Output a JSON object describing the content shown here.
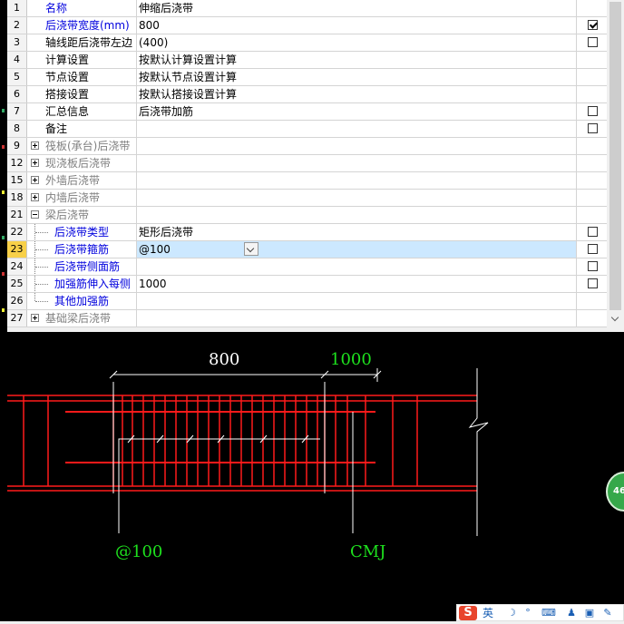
{
  "rows": [
    {
      "num": "1",
      "name": "名称",
      "value": "伸缩后浇带",
      "color": "blue",
      "checkbox": null,
      "expand": null,
      "indent": 0
    },
    {
      "num": "2",
      "name": "后浇带宽度(mm)",
      "value": "800",
      "color": "blue",
      "checkbox": true,
      "expand": null,
      "indent": 0
    },
    {
      "num": "3",
      "name": "轴线距后浇带左边",
      "value": "(400)",
      "color": "black",
      "checkbox": false,
      "expand": null,
      "indent": 0
    },
    {
      "num": "4",
      "name": "计算设置",
      "value": "按默认计算设置计算",
      "color": "black",
      "checkbox": null,
      "expand": null,
      "indent": 0
    },
    {
      "num": "5",
      "name": "节点设置",
      "value": "按默认节点设置计算",
      "color": "black",
      "checkbox": null,
      "expand": null,
      "indent": 0
    },
    {
      "num": "6",
      "name": "搭接设置",
      "value": "按默认搭接设置计算",
      "color": "black",
      "checkbox": null,
      "expand": null,
      "indent": 0
    },
    {
      "num": "7",
      "name": "汇总信息",
      "value": "后浇带加筋",
      "color": "black",
      "checkbox": false,
      "expand": null,
      "indent": 0
    },
    {
      "num": "8",
      "name": "备注",
      "value": "",
      "color": "black",
      "checkbox": false,
      "expand": null,
      "indent": 0
    },
    {
      "num": "9",
      "name": "筏板(承台)后浇带",
      "value": "",
      "color": "gray",
      "checkbox": null,
      "expand": "plus",
      "indent": 0
    },
    {
      "num": "12",
      "name": "现浇板后浇带",
      "value": "",
      "color": "gray",
      "checkbox": null,
      "expand": "plus",
      "indent": 0
    },
    {
      "num": "15",
      "name": "外墙后浇带",
      "value": "",
      "color": "gray",
      "checkbox": null,
      "expand": "plus",
      "indent": 0
    },
    {
      "num": "18",
      "name": "内墙后浇带",
      "value": "",
      "color": "gray",
      "checkbox": null,
      "expand": "plus",
      "indent": 0
    },
    {
      "num": "21",
      "name": "梁后浇带",
      "value": "",
      "color": "gray",
      "checkbox": null,
      "expand": "minus",
      "indent": 0
    },
    {
      "num": "22",
      "name": "后浇带类型",
      "value": "矩形后浇带",
      "color": "blue",
      "checkbox": false,
      "expand": null,
      "indent": 1
    },
    {
      "num": "23",
      "name": "后浇带箍筋",
      "value": "@100",
      "color": "blue",
      "checkbox": false,
      "expand": null,
      "indent": 1,
      "selected": true,
      "dropdown": true
    },
    {
      "num": "24",
      "name": "后浇带侧面筋",
      "value": "",
      "color": "blue",
      "checkbox": false,
      "expand": null,
      "indent": 1
    },
    {
      "num": "25",
      "name": "加强筋伸入每侧",
      "value": "1000",
      "color": "blue",
      "checkbox": false,
      "expand": null,
      "indent": 1
    },
    {
      "num": "26",
      "name": "其他加强筋",
      "value": "",
      "color": "blue",
      "checkbox": null,
      "expand": null,
      "indent": 1,
      "last": true
    },
    {
      "num": "27",
      "name": "基础梁后浇带",
      "value": "",
      "color": "gray",
      "checkbox": null,
      "expand": "plus",
      "indent": 0
    }
  ],
  "drawing": {
    "dim_width": "800",
    "dim_extend": "1000",
    "label_stirrup": "@100",
    "label_cmj": "CMJ",
    "colors": {
      "red": "#ff1a1a",
      "white": "#ffffff",
      "green": "#1ee01e"
    }
  },
  "badge": "46",
  "ime": {
    "lang": "英"
  }
}
